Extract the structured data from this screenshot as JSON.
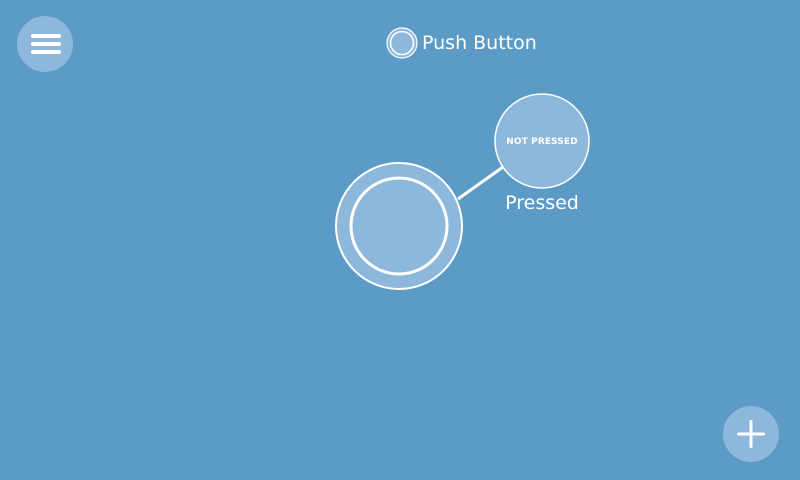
{
  "header": {
    "title": "Push Button",
    "icon": "push-button-icon"
  },
  "toolbar": {
    "menu_icon": "hamburger-menu-icon",
    "add_icon": "plus-icon"
  },
  "widget": {
    "type": "push-button",
    "state_label": "NOT PRESSED",
    "pressed_label": "Pressed"
  },
  "colors": {
    "background": "#5b9bc6",
    "button_fill": "#8db8db",
    "stroke": "#ffffff"
  }
}
